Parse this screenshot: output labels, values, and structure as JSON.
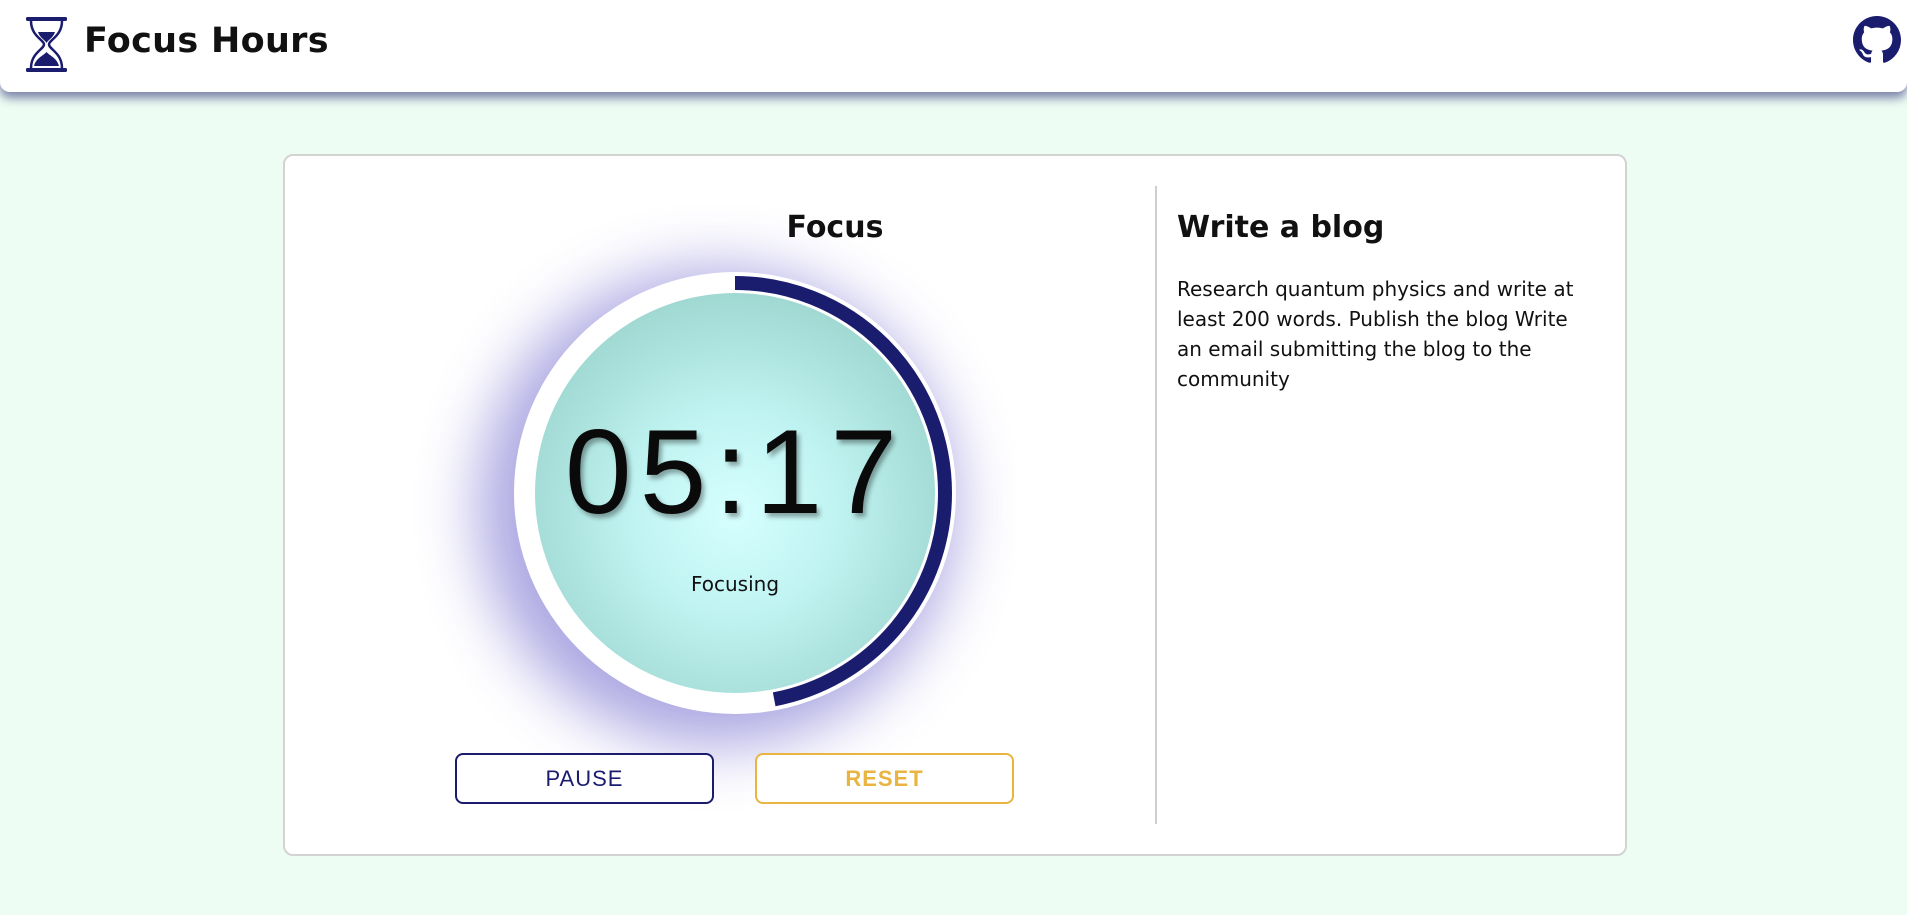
{
  "header": {
    "title": "Focus Hours",
    "logo_icon": "hourglass-icon",
    "github_icon": "github-icon"
  },
  "timer": {
    "mode": "Focus",
    "time": "05:17",
    "status": "Focusing",
    "progress": 0.47,
    "colors": {
      "progress": "#1a1c6e",
      "track": "#ffffff",
      "face": "#bff3f1"
    }
  },
  "controls": {
    "pause_label": "PAUSE",
    "reset_label": "RESET",
    "pause_color": "#1a1c6e",
    "reset_color": "#e9b43f"
  },
  "task": {
    "title": "Write a blog",
    "description": "Research quantum physics and write at least 200 words. Publish the blog Write an email submitting the blog to the community"
  }
}
